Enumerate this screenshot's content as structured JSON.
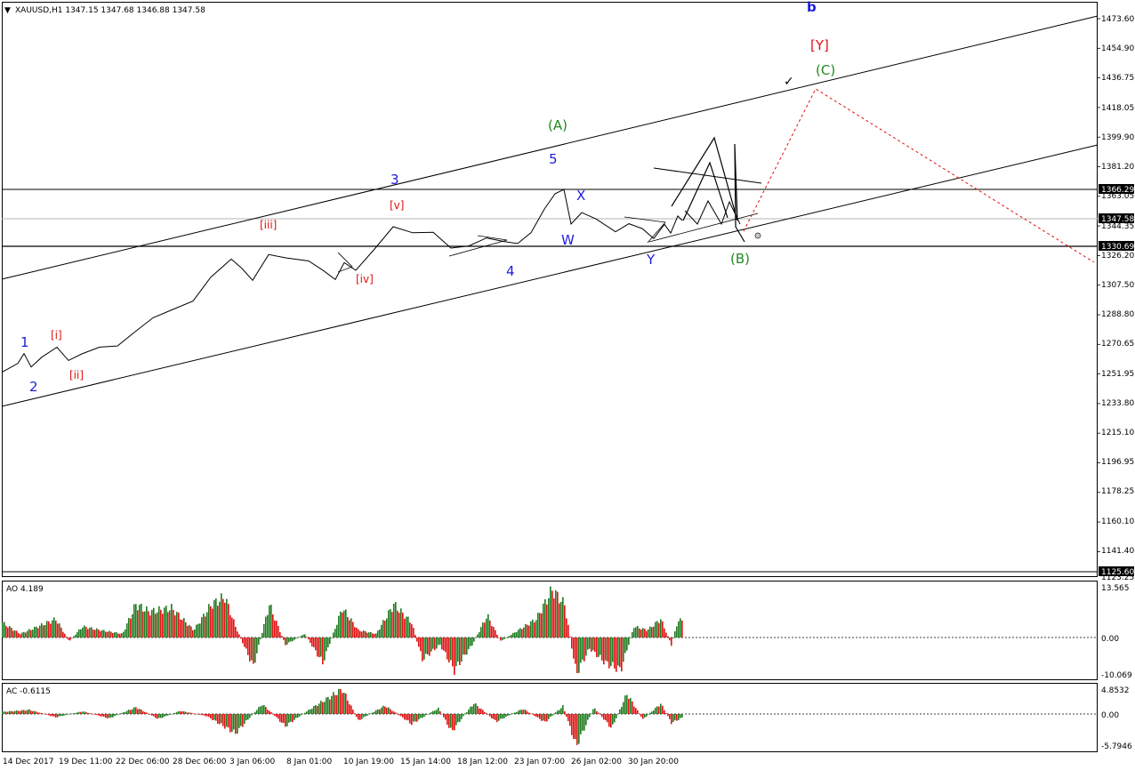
{
  "window": {
    "symbol_header": "XAUUSD,H1  1347.15 1347.68 1346.88 1347.58",
    "header_arrow": "▼"
  },
  "colors": {
    "blue_wave": "#1c1cdc",
    "red_wave": "#e01010",
    "green_wave": "#208a20",
    "osc_up": "#1f7a1f",
    "osc_down": "#e01010",
    "projection": "#e01010",
    "price_line": "#000000",
    "grid_line": "#000000"
  },
  "price_axis": {
    "ticks": [
      "1473.60",
      "1454.90",
      "1436.75",
      "1418.05",
      "1399.90",
      "1381.20",
      "1363.05",
      "1344.35",
      "1326.20",
      "1307.50",
      "1288.80",
      "1270.65",
      "1251.95",
      "1233.80",
      "1215.10",
      "1196.95",
      "1178.25",
      "1160.10",
      "1141.40",
      "1123.25"
    ],
    "badges": [
      "1366.29",
      "1347.58",
      "1330.69",
      "1125.60"
    ]
  },
  "time_axis": {
    "labels": [
      "14 Dec 2017",
      "19 Dec 11:00",
      "22 Dec 06:00",
      "28 Dec 06:00",
      "3 Jan 06:00",
      "8 Jan 01:00",
      "10 Jan 19:00",
      "15 Jan 14:00",
      "18 Jan 12:00",
      "23 Jan 07:00",
      "26 Jan 02:00",
      "30 Jan 20:00"
    ]
  },
  "wave_labels": {
    "w1": "1",
    "w2": "2",
    "w3": "3",
    "w4": "4",
    "w5": "5",
    "wi": "[i]",
    "wii": "[ii]",
    "wiii": "[iii]",
    "wiv": "[iv]",
    "wv": "[v]",
    "wA": "(A)",
    "wB": "(B)",
    "wC": "(C)",
    "wW": "W",
    "wX": "X",
    "wY": "Y",
    "wYY": "[Y]",
    "wb": "b",
    "check": "✓"
  },
  "ao": {
    "title": "AO 4.189",
    "ticks": [
      "13.565",
      "0.00",
      "-10.069"
    ]
  },
  "ac": {
    "title": "AC -0.6115",
    "ticks": [
      "4.8532",
      "0.00",
      "-5.7946"
    ]
  },
  "chart_data": {
    "type": "line",
    "title": "XAUUSD,H1",
    "ohlc_header": {
      "open": 1347.15,
      "high": 1347.68,
      "low": 1346.88,
      "close": 1347.58
    },
    "y_range": [
      1123.25,
      1480
    ],
    "x_labels": [
      "14 Dec 2017",
      "19 Dec 11:00",
      "22 Dec 06:00",
      "28 Dec 06:00",
      "3 Jan 06:00",
      "8 Jan 01:00",
      "10 Jan 19:00",
      "15 Jan 14:00",
      "18 Jan 12:00",
      "23 Jan 07:00",
      "26 Jan 02:00",
      "30 Jan 20:00"
    ],
    "price_series": [
      {
        "t": 0,
        "p": 1253
      },
      {
        "t": 18,
        "p": 1258
      },
      {
        "t": 25,
        "p": 1264
      },
      {
        "t": 33,
        "p": 1256
      },
      {
        "t": 45,
        "p": 1263
      },
      {
        "t": 62,
        "p": 1268
      },
      {
        "t": 75,
        "p": 1261
      },
      {
        "t": 90,
        "p": 1265
      },
      {
        "t": 110,
        "p": 1268
      },
      {
        "t": 130,
        "p": 1270
      },
      {
        "t": 150,
        "p": 1278
      },
      {
        "t": 170,
        "p": 1287
      },
      {
        "t": 190,
        "p": 1292
      },
      {
        "t": 215,
        "p": 1298
      },
      {
        "t": 235,
        "p": 1312
      },
      {
        "t": 258,
        "p": 1323
      },
      {
        "t": 270,
        "p": 1318
      },
      {
        "t": 282,
        "p": 1311
      },
      {
        "t": 300,
        "p": 1327
      },
      {
        "t": 320,
        "p": 1324
      },
      {
        "t": 345,
        "p": 1323
      },
      {
        "t": 362,
        "p": 1316
      },
      {
        "t": 375,
        "p": 1311
      },
      {
        "t": 385,
        "p": 1322
      },
      {
        "t": 398,
        "p": 1316
      },
      {
        "t": 420,
        "p": 1330
      },
      {
        "t": 440,
        "p": 1344
      },
      {
        "t": 462,
        "p": 1340
      },
      {
        "t": 485,
        "p": 1341
      },
      {
        "t": 505,
        "p": 1330
      },
      {
        "t": 525,
        "p": 1332
      },
      {
        "t": 545,
        "p": 1337
      },
      {
        "t": 565,
        "p": 1334
      },
      {
        "t": 580,
        "p": 1333
      },
      {
        "t": 595,
        "p": 1340
      },
      {
        "t": 610,
        "p": 1355
      },
      {
        "t": 622,
        "p": 1365
      },
      {
        "t": 632,
        "p": 1367
      },
      {
        "t": 640,
        "p": 1346
      },
      {
        "t": 652,
        "p": 1353
      },
      {
        "t": 668,
        "p": 1348
      },
      {
        "t": 690,
        "p": 1340
      },
      {
        "t": 705,
        "p": 1345
      },
      {
        "t": 720,
        "p": 1342
      },
      {
        "t": 733,
        "p": 1337
      },
      {
        "t": 745,
        "p": 1345
      },
      {
        "t": 752,
        "p": 1340
      },
      {
        "t": 760,
        "p": 1350
      },
      {
        "t": 765,
        "p": 1347.58
      }
    ],
    "horizontal_levels": [
      1366.29,
      1347.58,
      1330.69,
      1125.6
    ],
    "ao_series": [
      {
        "t": 0,
        "v": 4
      },
      {
        "t": 20,
        "v": 1
      },
      {
        "t": 40,
        "v": 3
      },
      {
        "t": 60,
        "v": 5
      },
      {
        "t": 75,
        "v": -1
      },
      {
        "t": 90,
        "v": 3
      },
      {
        "t": 110,
        "v": 2
      },
      {
        "t": 135,
        "v": 1
      },
      {
        "t": 150,
        "v": 9
      },
      {
        "t": 165,
        "v": 7
      },
      {
        "t": 190,
        "v": 8
      },
      {
        "t": 215,
        "v": 2
      },
      {
        "t": 235,
        "v": 9
      },
      {
        "t": 250,
        "v": 11
      },
      {
        "t": 262,
        "v": 3
      },
      {
        "t": 282,
        "v": -8
      },
      {
        "t": 300,
        "v": 9
      },
      {
        "t": 318,
        "v": -2
      },
      {
        "t": 340,
        "v": 1
      },
      {
        "t": 360,
        "v": -7
      },
      {
        "t": 382,
        "v": 8
      },
      {
        "t": 400,
        "v": 2
      },
      {
        "t": 420,
        "v": 1
      },
      {
        "t": 440,
        "v": 9
      },
      {
        "t": 460,
        "v": 4
      },
      {
        "t": 472,
        "v": -6
      },
      {
        "t": 492,
        "v": -2
      },
      {
        "t": 508,
        "v": -9
      },
      {
        "t": 528,
        "v": -2
      },
      {
        "t": 545,
        "v": 6
      },
      {
        "t": 560,
        "v": -1
      },
      {
        "t": 580,
        "v": 2
      },
      {
        "t": 600,
        "v": 5
      },
      {
        "t": 618,
        "v": 13
      },
      {
        "t": 632,
        "v": 9
      },
      {
        "t": 645,
        "v": -10
      },
      {
        "t": 660,
        "v": -3
      },
      {
        "t": 678,
        "v": -7
      },
      {
        "t": 695,
        "v": -9
      },
      {
        "t": 710,
        "v": 3
      },
      {
        "t": 725,
        "v": 2
      },
      {
        "t": 740,
        "v": 5
      },
      {
        "t": 752,
        "v": -2
      },
      {
        "t": 760,
        "v": 5
      },
      {
        "t": 765,
        "v": 4.189
      }
    ],
    "ac_series": [
      {
        "t": 0,
        "v": 0.4
      },
      {
        "t": 30,
        "v": 0.8
      },
      {
        "t": 60,
        "v": -0.6
      },
      {
        "t": 90,
        "v": 0.5
      },
      {
        "t": 120,
        "v": -0.8
      },
      {
        "t": 150,
        "v": 1.3
      },
      {
        "t": 175,
        "v": -0.9
      },
      {
        "t": 200,
        "v": 0.6
      },
      {
        "t": 230,
        "v": -0.4
      },
      {
        "t": 262,
        "v": -3.5
      },
      {
        "t": 292,
        "v": 1.9
      },
      {
        "t": 318,
        "v": -2.2
      },
      {
        "t": 350,
        "v": 1.4
      },
      {
        "t": 382,
        "v": 4.8
      },
      {
        "t": 400,
        "v": -1.2
      },
      {
        "t": 430,
        "v": 1.6
      },
      {
        "t": 460,
        "v": -1.8
      },
      {
        "t": 490,
        "v": 1.1
      },
      {
        "t": 505,
        "v": -3.2
      },
      {
        "t": 530,
        "v": 2.1
      },
      {
        "t": 555,
        "v": -1.4
      },
      {
        "t": 585,
        "v": 1.0
      },
      {
        "t": 610,
        "v": -1.5
      },
      {
        "t": 630,
        "v": 1.5
      },
      {
        "t": 645,
        "v": -5.8
      },
      {
        "t": 665,
        "v": 1.2
      },
      {
        "t": 685,
        "v": -2.6
      },
      {
        "t": 702,
        "v": 3.9
      },
      {
        "t": 720,
        "v": -1.0
      },
      {
        "t": 740,
        "v": 2.0
      },
      {
        "t": 752,
        "v": -1.6
      },
      {
        "t": 765,
        "v": -0.6115
      }
    ]
  }
}
